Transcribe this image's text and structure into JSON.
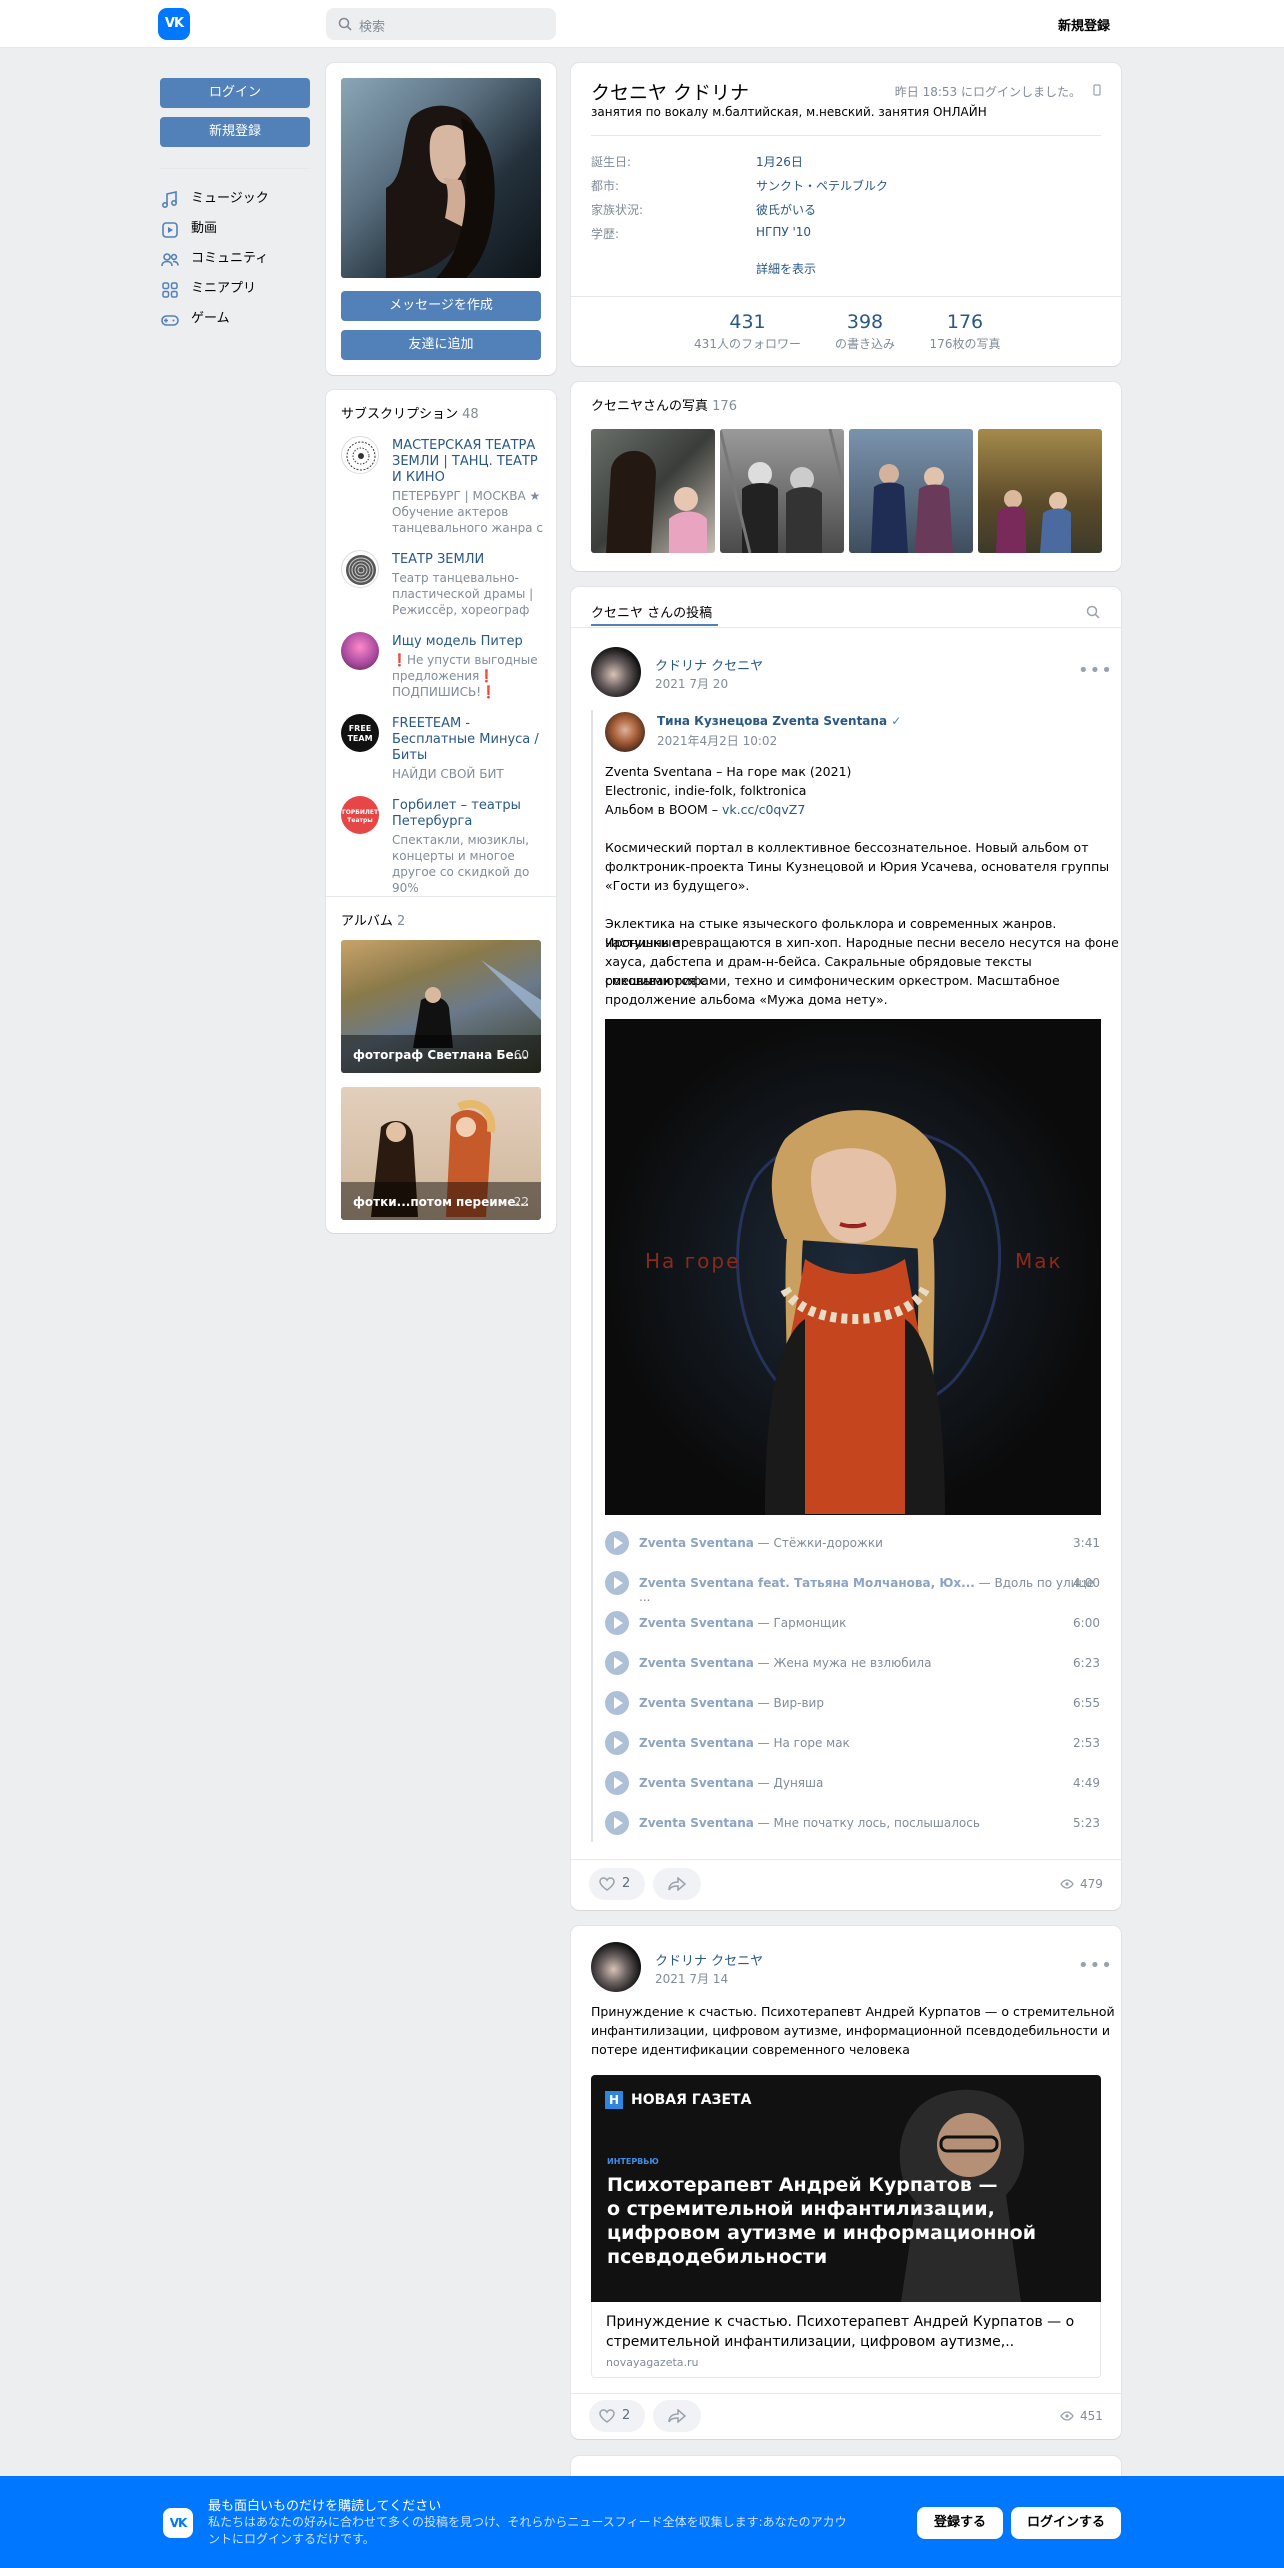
{
  "header": {
    "logo_text": "VK",
    "search_placeholder": "検索",
    "register_label": "新規登録"
  },
  "left_nav": {
    "login_button": "ログイン",
    "register_button": "新規登録",
    "items": [
      {
        "label": "ミュージック",
        "icon": "music-note-icon"
      },
      {
        "label": "動画",
        "icon": "video-icon"
      },
      {
        "label": "コミュニティ",
        "icon": "users-icon"
      },
      {
        "label": "ミニアプリ",
        "icon": "apps-icon"
      },
      {
        "label": "ゲーム",
        "icon": "gamepad-icon"
      }
    ]
  },
  "profile": {
    "name": "クセニヤ クドリナ",
    "status": "занятия по вокалу м.балтийская, м.невский. занятия ОНЛАЙН",
    "last_seen": "昨日 18:53 にログインしました。",
    "message_button": "メッセージを作成",
    "add_friend_button": "友達に追加",
    "info": [
      {
        "label": "誕生日:",
        "value": "1月26日"
      },
      {
        "label": "都市:",
        "value": "サンクト・ペテルブルク"
      },
      {
        "label": "家族状況:",
        "value": "彼氏がいる"
      },
      {
        "label": "学歴:",
        "value": "НГПУ '10"
      }
    ],
    "details_link": "詳細を表示",
    "counters": [
      {
        "value": "431",
        "label": "431人のフォロワー"
      },
      {
        "value": "398",
        "label": "の書き込み"
      },
      {
        "value": "176",
        "label": "176枚の写真"
      }
    ]
  },
  "subscriptions": {
    "title": "サブスクリプション",
    "count": "48",
    "items": [
      {
        "title": "МАСТЕРСКАЯ ТЕАТРА ЗЕМЛИ | ТАНЦ. ТЕАТР И КИНО",
        "desc": "ПЕТЕРБУРГ | МОСКВА ★ Обучение актеров танцевального жанра с"
      },
      {
        "title": "ТЕАТР ЗЕМЛИ",
        "desc": "Театр танцевально-пластической драмы | Режиссёр, хореограф —"
      },
      {
        "title": "Ищу модель Питер",
        "desc": "❗Не упусти выгодные предложения❗ ПОДПИШИСЬ!❗"
      },
      {
        "title": "FREETEAM - Бесплатные Минуса / Биты",
        "desc": "НАЙДИ СВОЙ БИТ"
      },
      {
        "title": "Горбилет – театры Петербурга",
        "desc": "Спектакли, мюзиклы, концерты и многое другое со скидкой до 90%"
      }
    ]
  },
  "albums": {
    "title": "アルバム",
    "count": "2",
    "items": [
      {
        "name": "фотограф Светлана Бе...",
        "count": "60"
      },
      {
        "name": "фотки...потом переиме...",
        "count": "22"
      }
    ]
  },
  "photos": {
    "title": "クセニヤさんの写真",
    "count": "176"
  },
  "wall": {
    "tab_label": "クセニヤ さんの投稿",
    "posts": [
      {
        "author": "クドリナ クセニヤ",
        "date": "2021 7月 20",
        "repost_author": "Тина Кузнецова Zventa Sventana",
        "repost_date": "2021年4月2日 10:02",
        "text_lines": [
          "Zventa Sventana – На горе мак (2021)",
          "Electronic, indie-folk, folktronica"
        ],
        "album_prefix": "Альбом в BOOM – ",
        "album_link": "vk.cc/c0qvZ7",
        "para2": [
          "Космический портал в коллективное бессознательное. Новый альбом от",
          "фолктроник-проекта Тины Кузнецовой и Юрия Усачева, основателя группы",
          "«Гости из будущего»."
        ],
        "para3": [
          "Эклектика на стыке языческого фольклора и современных жанров. Ироничные",
          "частушки превращаются в хип-хоп. Народные песни весело несутся на фоне",
          "хауса, дабстепа и драм-н-бейса. Сакральные обрядовые тексты смешиваются с",
          "роковыми рифами, техно и симфоническим оркестром. Масштабное",
          "продолжение альбома «Мужа дома нету»."
        ],
        "cover_left": "На горе",
        "cover_right": "Мак",
        "tracks": [
          {
            "artist": "Zventa Sventana",
            "title": "Стёжки-дорожки",
            "duration": "3:41"
          },
          {
            "artist": "Zventa Sventana feat. Татьяна Молчанова, Юх...",
            "title": "Вдоль по улице ...",
            "duration": "4:00"
          },
          {
            "artist": "Zventa Sventana",
            "title": "Гармонщик",
            "duration": "6:00"
          },
          {
            "artist": "Zventa Sventana",
            "title": "Жена мужа не взлюбила",
            "duration": "6:23"
          },
          {
            "artist": "Zventa Sventana",
            "title": "Вир-вир",
            "duration": "6:55"
          },
          {
            "artist": "Zventa Sventana",
            "title": "На горе мак",
            "duration": "2:53"
          },
          {
            "artist": "Zventa Sventana",
            "title": "Дуняша",
            "duration": "4:49"
          },
          {
            "artist": "Zventa Sventana",
            "title": "Мне початку лось, послышалось",
            "duration": "5:23"
          }
        ],
        "likes": "2",
        "views": "479"
      },
      {
        "author": "クドリナ クセニヤ",
        "date": "2021 7月 14",
        "text_lines": [
          "Принуждение к счастью. Психотерапевт Андрей Курпатов — о стремительной",
          "инфантилизации, цифровом аутизме, информационной псевдодебильности и",
          "потере идентификации современного человека"
        ],
        "card_brand": "НОВАЯ ГАЗЕТА",
        "card_tag": "ИНТЕРВЬЮ",
        "card_headline": [
          "Психотерапевт Андрей Курпатов —",
          "о стремительной инфантилизации,",
          "цифровом аутизме и информационной",
          "псевдодебильности"
        ],
        "link_title": [
          "Принуждение к счастью. Психотерапевт Андрей Курпатов — о",
          "стремительной инфантилизации, цифровом аутизме,.."
        ],
        "link_domain": "novayagazeta.ru",
        "likes": "2",
        "views": "451"
      }
    ]
  },
  "bottom_banner": {
    "title": "最も面白いものだけを購読してください",
    "text": [
      "私たちはあなたの好みに合わせて多くの投稿を見つけ、それらからニュースフィード全体を収集します:あなたのアカウ",
      "ントにログインするだけです。"
    ],
    "register_button": "登録する",
    "login_button": "ログインする"
  }
}
